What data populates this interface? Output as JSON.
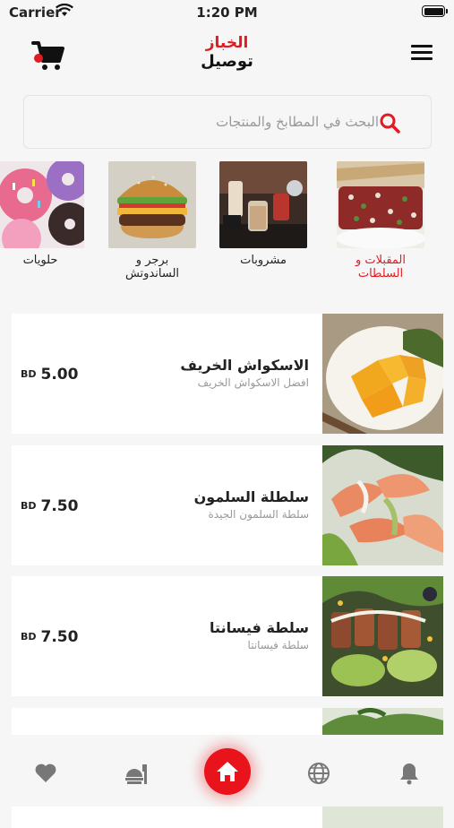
{
  "status_bar": {
    "carrier": "Carrier",
    "time": "1:20 PM"
  },
  "header": {
    "brand_top": "الخباز",
    "brand_bottom": "توصيل"
  },
  "search": {
    "placeholder": "البحث في المطابخ والمنتجات"
  },
  "categories": [
    {
      "label": "المقبلات و السلطات",
      "active": true
    },
    {
      "label": "مشروبات",
      "active": false
    },
    {
      "label": "برجر و الساندوتش",
      "active": false
    },
    {
      "label": "حلويات",
      "active": false
    }
  ],
  "products": [
    {
      "title": "الاسكواش الخريف",
      "subtitle": "افضل الاسكواش الخريف",
      "currency": "BD",
      "price": "5.00"
    },
    {
      "title": "سلطلة السلمون",
      "subtitle": "سلطة السلمون الجيدة",
      "currency": "BD",
      "price": "7.50"
    },
    {
      "title": "سلطة فيسانتا",
      "subtitle": "سلطة فيسانتا",
      "currency": "BD",
      "price": "7.50"
    }
  ],
  "colors": {
    "accent": "#e11b22",
    "background": "#f6f6f6",
    "card": "#ffffff"
  },
  "tabbar": {
    "icons": [
      "heart-icon",
      "food-icon",
      "home-icon",
      "globe-icon",
      "bell-icon"
    ]
  }
}
